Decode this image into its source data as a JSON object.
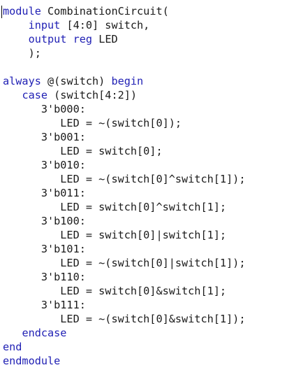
{
  "editor": {
    "lines": [
      [
        {
          "t": "module",
          "k": true
        },
        {
          "t": " CombinationCircuit(",
          "k": false
        }
      ],
      [
        {
          "t": "    ",
          "k": false
        },
        {
          "t": "input",
          "k": true
        },
        {
          "t": " [4:0] switch,",
          "k": false
        }
      ],
      [
        {
          "t": "    ",
          "k": false
        },
        {
          "t": "output",
          "k": true
        },
        {
          "t": " ",
          "k": false
        },
        {
          "t": "reg",
          "k": true
        },
        {
          "t": " LED",
          "k": false
        }
      ],
      [
        {
          "t": "    );",
          "k": false
        }
      ],
      [],
      [
        {
          "t": "always",
          "k": true
        },
        {
          "t": " @(switch) ",
          "k": false
        },
        {
          "t": "begin",
          "k": true
        }
      ],
      [
        {
          "t": "   ",
          "k": false
        },
        {
          "t": "case",
          "k": true
        },
        {
          "t": " (switch[4:2])",
          "k": false
        }
      ],
      [
        {
          "t": "      3'b000:",
          "k": false
        }
      ],
      [
        {
          "t": "         LED = ~(switch[0]);",
          "k": false
        }
      ],
      [
        {
          "t": "      3'b001:",
          "k": false
        }
      ],
      [
        {
          "t": "         LED = switch[0];",
          "k": false
        }
      ],
      [
        {
          "t": "      3'b010:",
          "k": false
        }
      ],
      [
        {
          "t": "         LED = ~(switch[0]^switch[1]);",
          "k": false
        }
      ],
      [
        {
          "t": "      3'b011:",
          "k": false
        }
      ],
      [
        {
          "t": "         LED = switch[0]^switch[1];",
          "k": false
        }
      ],
      [
        {
          "t": "      3'b100:",
          "k": false
        }
      ],
      [
        {
          "t": "         LED = switch[0]|switch[1];",
          "k": false
        }
      ],
      [
        {
          "t": "      3'b101:",
          "k": false
        }
      ],
      [
        {
          "t": "         LED = ~(switch[0]|switch[1]);",
          "k": false
        }
      ],
      [
        {
          "t": "      3'b110:",
          "k": false
        }
      ],
      [
        {
          "t": "         LED = switch[0]&switch[1];",
          "k": false
        }
      ],
      [
        {
          "t": "      3'b111:",
          "k": false
        }
      ],
      [
        {
          "t": "         LED = ~(switch[0]&switch[1]);",
          "k": false
        }
      ],
      [
        {
          "t": "   ",
          "k": false
        },
        {
          "t": "endcase",
          "k": true
        }
      ],
      [
        {
          "t": "end",
          "k": true
        }
      ],
      [
        {
          "t": "endmodule",
          "k": true
        }
      ]
    ]
  },
  "colors": {
    "keyword": "#1f1fb4",
    "text": "#1a1a1a",
    "background": "#ffffff"
  }
}
